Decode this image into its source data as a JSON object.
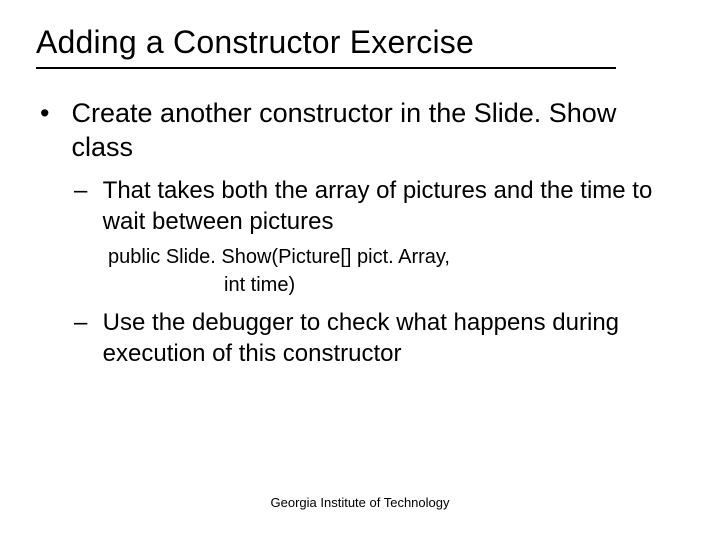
{
  "title": "Adding a Constructor Exercise",
  "bullet1": "Create another constructor in the Slide. Show class",
  "sub1": "That takes both the array of pictures and the time to wait between pictures",
  "code_line1": "public Slide. Show(Picture[] pict. Array,",
  "code_line2": "int time)",
  "sub2": "Use the debugger to check what happens during execution of this constructor",
  "footer": "Georgia Institute of Technology"
}
